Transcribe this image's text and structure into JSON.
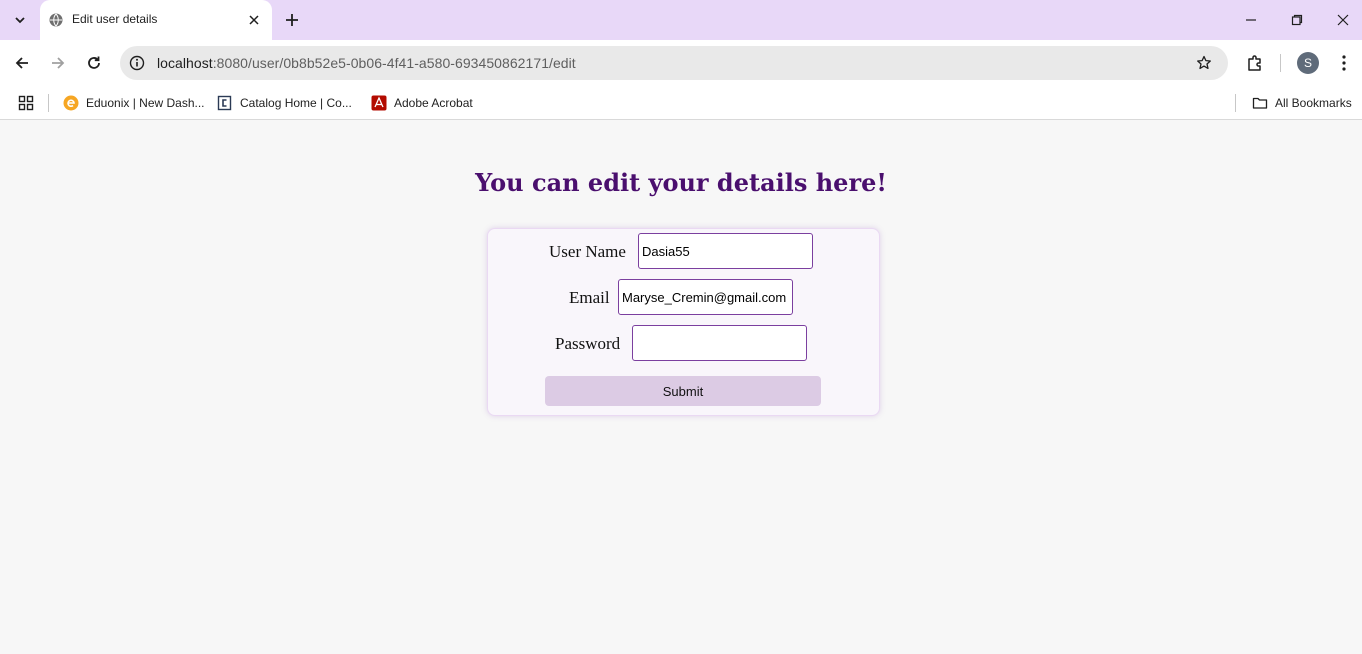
{
  "browser": {
    "tab": {
      "title": "Edit user details"
    },
    "url": {
      "host": "localhost",
      "path": ":8080/user/0b8b52e5-0b06-4f41-a580-693450862171/edit"
    },
    "profile_initial": "S",
    "bookmarks": [
      {
        "label": "Eduonix | New Dash...",
        "icon": "eduonix-icon"
      },
      {
        "label": "Catalog Home | Co...",
        "icon": "catalog-icon"
      },
      {
        "label": "Adobe Acrobat",
        "icon": "acrobat-icon"
      }
    ],
    "all_bookmarks": "All Bookmarks"
  },
  "page": {
    "heading": "You can edit your details here!",
    "form": {
      "username_label": "User Name",
      "username_value": "Dasia55",
      "email_label": "Email",
      "email_value": "Maryse_Cremin@gmail.com",
      "password_label": "Password",
      "password_value": "",
      "submit_label": "Submit"
    }
  },
  "colors": {
    "tabstrip": "#e8d8f8",
    "heading": "#4a0f6e",
    "field_border": "#7b3f9f",
    "submit_bg": "#dccbe4"
  }
}
